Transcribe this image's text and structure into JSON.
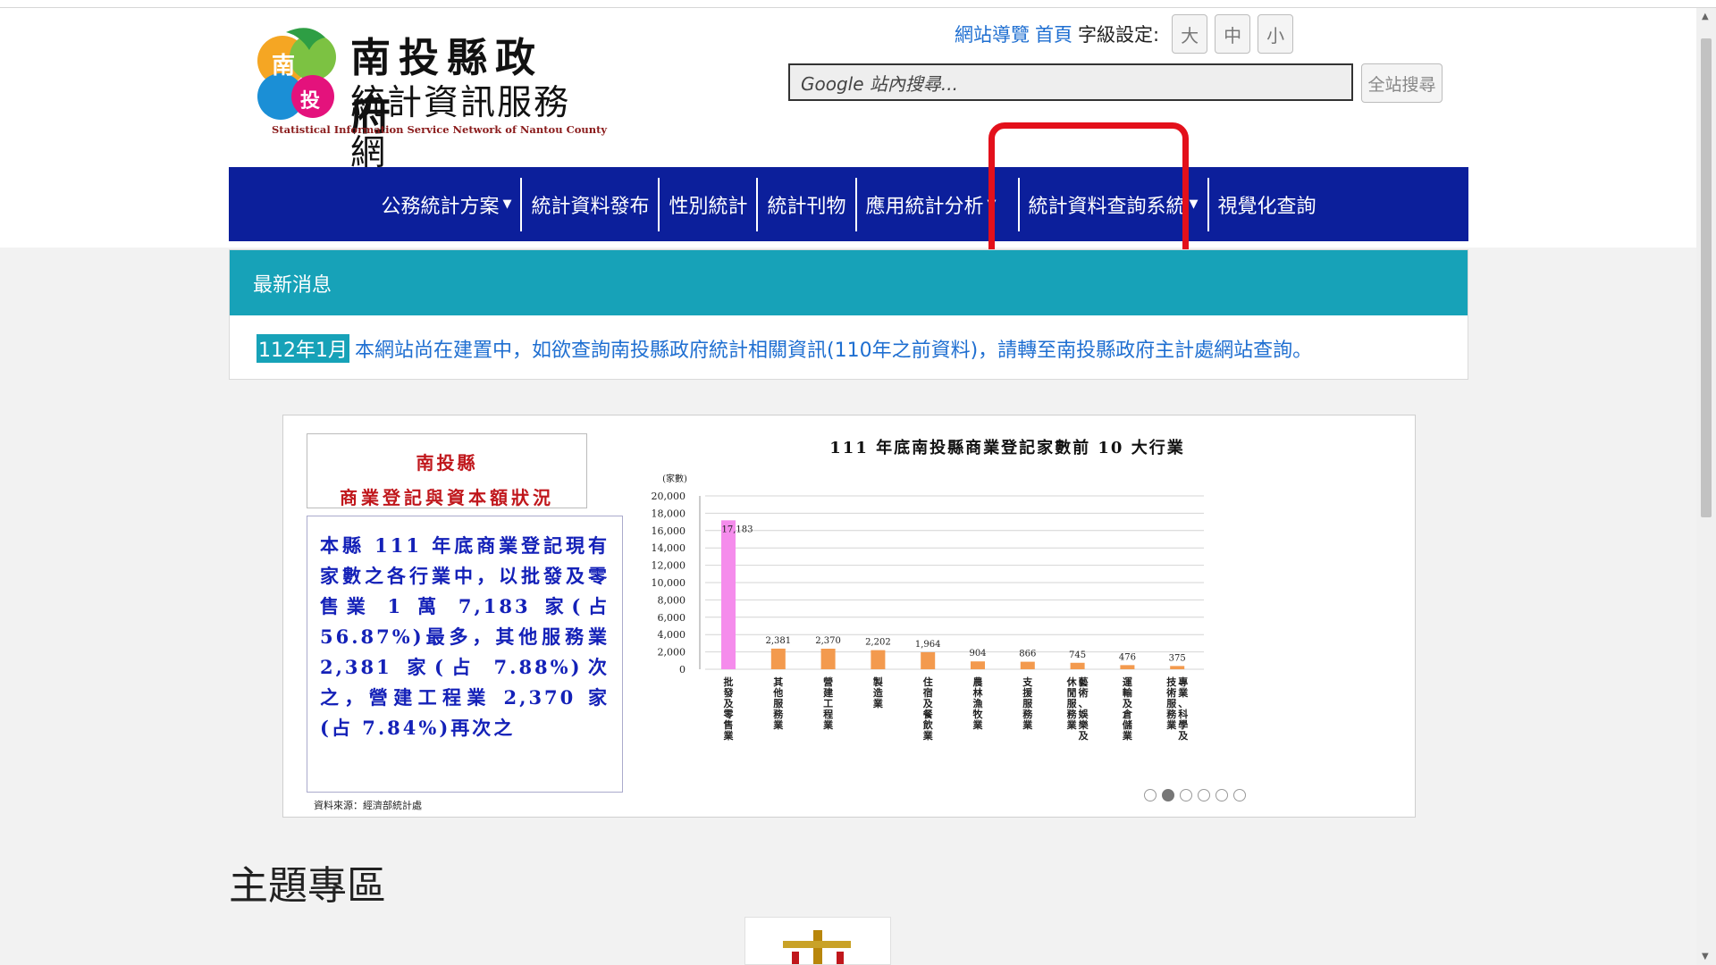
{
  "header": {
    "logo_title1": "南投縣政府",
    "logo_title2": "統計資訊服務網",
    "logo_subtitle": "Statistical Information Service Network of Nantou County",
    "links": {
      "sitemap": "網站導覽",
      "home": "首頁",
      "font_label": "字級設定:"
    },
    "font_sizes": [
      "大",
      "中",
      "小"
    ],
    "search_placeholder": "Google 站內搜尋...",
    "search_button": "全站搜尋"
  },
  "nav": {
    "items": [
      {
        "label": "公務統計方案",
        "dropdown": true
      },
      {
        "label": "統計資料發布",
        "dropdown": false
      },
      {
        "label": "性別統計",
        "dropdown": false
      },
      {
        "label": "統計刊物",
        "dropdown": false
      },
      {
        "label": "應用統計分析",
        "dropdown": true
      },
      {
        "label": "統計資料查詢系統",
        "dropdown": true
      },
      {
        "label": "視覺化查詢",
        "dropdown": false
      }
    ],
    "caret": "▼"
  },
  "news": {
    "heading": "最新消息",
    "date": "112年1月",
    "text": "本網站尚在建置中，如欲查詢南投縣政府統計相關資訊(110年之前資料)，請轉至南投縣政府主計處網站查詢。"
  },
  "banner": {
    "left_title1": "南投縣",
    "left_title2": "商業登記與資本額狀況",
    "left_text": "本縣 111 年底商業登記現有家數之各行業中，以批發及零售業 1 萬 7,183 家(占 56.87%)最多，其他服務業 2,381 家(占 7.88%)次之，營建工程業 2,370 家(占 7.84%)再次之",
    "source": "資料來源：經濟部統計處",
    "slide_count": 6,
    "active_slide": 2
  },
  "chart_data": {
    "type": "bar",
    "title": "111 年底南投縣商業登記家數前 10 大行業",
    "ylabel": "(家數)",
    "ylim": [
      0,
      20000
    ],
    "yticks": [
      "0",
      "2,000",
      "4,000",
      "6,000",
      "8,000",
      "10,000",
      "12,000",
      "14,000",
      "16,000",
      "18,000",
      "20,000"
    ],
    "categories": [
      "批發及零售業",
      "其他服務業",
      "營建工程業",
      "製造業",
      "住宿及餐飲業",
      "農林漁牧業",
      "支援服務業",
      "藝術、娛樂及休閒服務業",
      "運輸及倉儲業",
      "專業、科學及技術服務業"
    ],
    "values": [
      17183,
      2381,
      2370,
      2202,
      1964,
      904,
      866,
      745,
      476,
      375
    ],
    "value_labels": [
      "17,183",
      "2,381",
      "2,370",
      "2,202",
      "1,964",
      "904",
      "866",
      "745",
      "476",
      "375"
    ],
    "colors": [
      "#f58cec",
      "#f39a4e"
    ],
    "grid": true
  },
  "section": {
    "title": "主題專區"
  }
}
